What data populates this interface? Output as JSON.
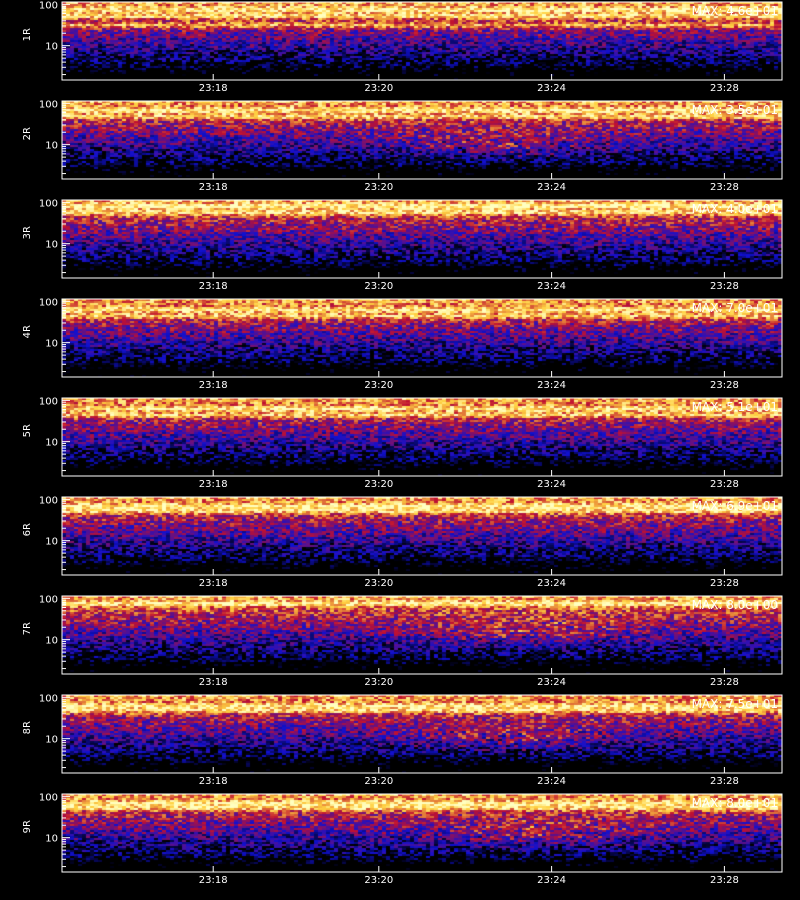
{
  "chart_data": {
    "type": "heatmap",
    "x_ticks": [
      "23:18",
      "23:20",
      "23:24",
      "23:28"
    ],
    "y_ticks": [
      "100",
      "10"
    ],
    "xlabel": "",
    "colors": {
      "background": "#000000",
      "low": "#1010d0",
      "mid": "#c01030",
      "high": "#ffd040",
      "peak": "#ffffc0"
    },
    "panels": [
      {
        "ylabel": "1R",
        "max_label": "MAX: 4.6e+01",
        "max": 46,
        "bright_rows": [
          0.3,
          0.18,
          0.1
        ],
        "hotspot": null
      },
      {
        "ylabel": "2R",
        "max_label": "MAX: 3.5e+01",
        "max": 35,
        "bright_rows": [
          0.2,
          0.12
        ],
        "hotspot": [
          0.6,
          0.55
        ]
      },
      {
        "ylabel": "3R",
        "max_label": "MAX: 4.0e+01",
        "max": 40,
        "bright_rows": [
          0.16,
          0.08
        ],
        "hotspot": null
      },
      {
        "ylabel": "4R",
        "max_label": "MAX: 7.0e+01",
        "max": 70,
        "bright_rows": [
          0.22,
          0.14
        ],
        "hotspot": null
      },
      {
        "ylabel": "5R",
        "max_label": "MAX: 5.1e+01",
        "max": 51,
        "bright_rows": [
          0.14,
          0.22
        ],
        "hotspot": null
      },
      {
        "ylabel": "6R",
        "max_label": "MAX: 6.9e+01",
        "max": 69,
        "bright_rows": [
          0.18,
          0.12
        ],
        "hotspot": null
      },
      {
        "ylabel": "7R",
        "max_label": "MAX: 8.0e+00",
        "max": 8,
        "bright_rows": [
          0.1
        ],
        "hotspot": [
          0.65,
          0.45
        ]
      },
      {
        "ylabel": "8R",
        "max_label": "MAX: 7.5e+01",
        "max": 75,
        "bright_rows": [
          0.14,
          0.2
        ],
        "hotspot": [
          0.62,
          0.55
        ]
      },
      {
        "ylabel": "9R",
        "max_label": "MAX: 8.0e+01",
        "max": 80,
        "bright_rows": [
          0.18,
          0.12
        ],
        "hotspot": [
          0.66,
          0.5
        ]
      }
    ]
  }
}
